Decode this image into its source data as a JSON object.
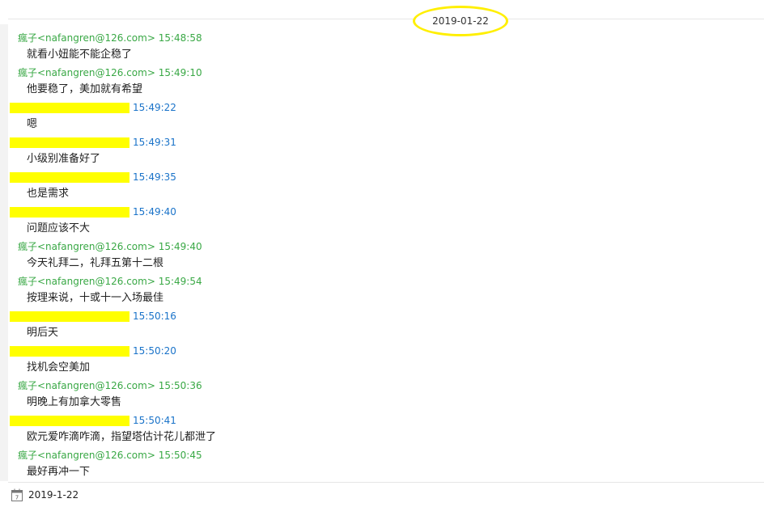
{
  "header": {
    "date": "2019-01-22"
  },
  "messages": [
    {
      "type": "other",
      "sender": "瘋子<nafangren@126.com>",
      "time": "15:48:58",
      "text": "就看小妞能不能企稳了"
    },
    {
      "type": "other",
      "sender": "瘋子<nafangren@126.com>",
      "time": "15:49:10",
      "text": "他要稳了，美加就有希望"
    },
    {
      "type": "self",
      "sender": "",
      "time": "15:49:22",
      "text": "嗯"
    },
    {
      "type": "self",
      "sender": "",
      "time": "15:49:31",
      "text": "小级别准备好了"
    },
    {
      "type": "self",
      "sender": "",
      "time": "15:49:35",
      "text": "也是需求"
    },
    {
      "type": "self",
      "sender": "",
      "time": "15:49:40",
      "text": "问题应该不大"
    },
    {
      "type": "other",
      "sender": "瘋子<nafangren@126.com>",
      "time": "15:49:40",
      "text": "今天礼拜二，礼拜五第十二根"
    },
    {
      "type": "other",
      "sender": "瘋子<nafangren@126.com>",
      "time": "15:49:54",
      "text": "按理来说，十或十一入场最佳"
    },
    {
      "type": "self",
      "sender": "",
      "time": "15:50:16",
      "text": "明后天"
    },
    {
      "type": "self",
      "sender": "",
      "time": "15:50:20",
      "text": "找机会空美加"
    },
    {
      "type": "other",
      "sender": "瘋子<nafangren@126.com>",
      "time": "15:50:36",
      "text": "明晚上有加拿大零售"
    },
    {
      "type": "self",
      "sender": "",
      "time": "15:50:41",
      "text": "欧元爱咋滴咋滴，指望塔估计花儿都泄了"
    },
    {
      "type": "other",
      "sender": "瘋子<nafangren@126.com>",
      "time": "15:50:45",
      "text": "最好再冲一下"
    }
  ],
  "footer": {
    "date": "2019-1-22",
    "icon": "calendar-icon"
  },
  "colors": {
    "other_sender": "#39a845",
    "self_time": "#1a73c9",
    "highlight": "#ffff00",
    "circle": "#ffef00"
  }
}
